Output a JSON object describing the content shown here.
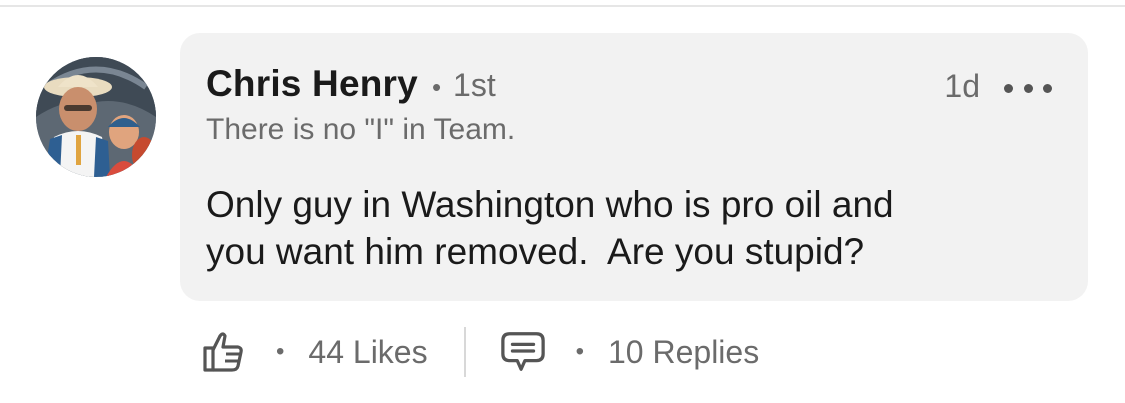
{
  "comment": {
    "author": {
      "name": "Chris Henry",
      "degree": "1st",
      "headline": "There is no \"I\" in Team.",
      "avatar_icon": "profile-photo-icon"
    },
    "separator": "•",
    "time_ago": "1d",
    "more_icon": "more-options-icon",
    "text": "Only guy in Washington who is pro oil and\nyou want him removed.  Are you stupid?"
  },
  "actions": {
    "separator": "•",
    "like": {
      "icon": "thumbs-up-icon",
      "label": "44 Likes"
    },
    "reply": {
      "icon": "comment-bubble-icon",
      "label": "10 Replies"
    }
  },
  "colors": {
    "bubble_background": "#f2f2f2",
    "primary_text": "#1a1a1a",
    "secondary_text": "#6b6b6b"
  }
}
